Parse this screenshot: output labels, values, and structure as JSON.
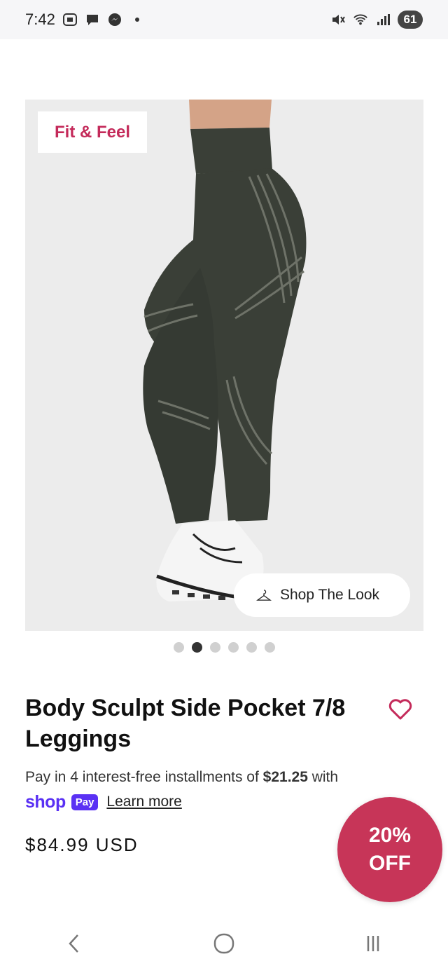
{
  "status_bar": {
    "time": "7:42",
    "battery": "61"
  },
  "product": {
    "badge": "Fit & Feel",
    "shop_the_look": "Shop The Look",
    "carousel": {
      "count": 6,
      "active_index": 1
    },
    "title": "Body Sculpt Side Pocket 7/8 Leggings",
    "installments_prefix": "Pay in 4 interest-free installments of ",
    "installment_amount": "$21.25",
    "installments_suffix": " with",
    "shop_word": "shop",
    "pay_pill": "Pay",
    "learn_more": "Learn more",
    "price": "$84.99 USD"
  },
  "promo": {
    "line1": "20%",
    "line2": "OFF"
  },
  "colors": {
    "brand_pink": "#c42a5a",
    "promo_red": "#c73558",
    "shop_pay_purple": "#5a31f4",
    "legging_green": "#3a3f37"
  },
  "icons": {
    "heart": "heart-outline-icon",
    "hanger": "hanger-icon",
    "back": "back-chevron-icon",
    "home": "home-circle-icon",
    "recents": "recents-icon"
  }
}
